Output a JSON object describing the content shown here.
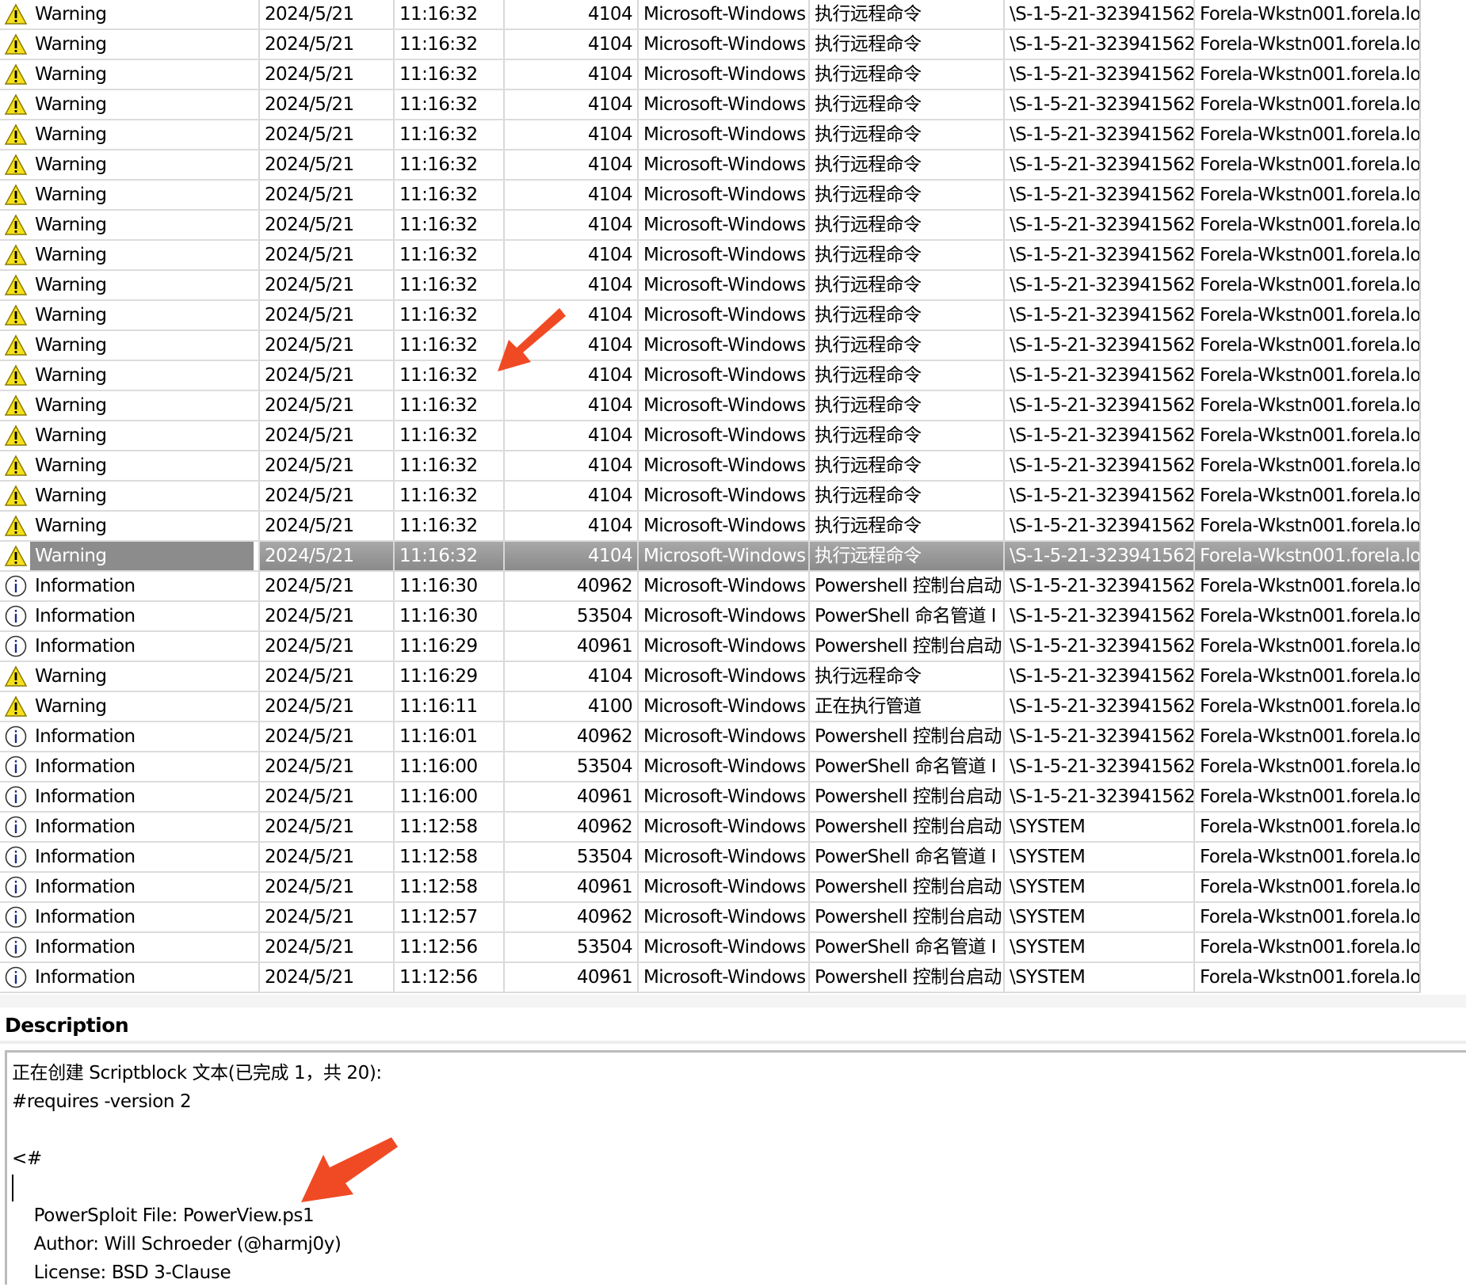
{
  "events": [
    {
      "level": "Warning",
      "date": "2024/5/21",
      "time": "11:16:32",
      "id": "4104",
      "source": "Microsoft-Windows",
      "task": "执行远程命令",
      "user": "\\S-1-5-21-323941562",
      "computer": "Forela-Wkstn001.forela.lo"
    },
    {
      "level": "Warning",
      "date": "2024/5/21",
      "time": "11:16:32",
      "id": "4104",
      "source": "Microsoft-Windows",
      "task": "执行远程命令",
      "user": "\\S-1-5-21-323941562",
      "computer": "Forela-Wkstn001.forela.lo"
    },
    {
      "level": "Warning",
      "date": "2024/5/21",
      "time": "11:16:32",
      "id": "4104",
      "source": "Microsoft-Windows",
      "task": "执行远程命令",
      "user": "\\S-1-5-21-323941562",
      "computer": "Forela-Wkstn001.forela.lo"
    },
    {
      "level": "Warning",
      "date": "2024/5/21",
      "time": "11:16:32",
      "id": "4104",
      "source": "Microsoft-Windows",
      "task": "执行远程命令",
      "user": "\\S-1-5-21-323941562",
      "computer": "Forela-Wkstn001.forela.lo"
    },
    {
      "level": "Warning",
      "date": "2024/5/21",
      "time": "11:16:32",
      "id": "4104",
      "source": "Microsoft-Windows",
      "task": "执行远程命令",
      "user": "\\S-1-5-21-323941562",
      "computer": "Forela-Wkstn001.forela.lo"
    },
    {
      "level": "Warning",
      "date": "2024/5/21",
      "time": "11:16:32",
      "id": "4104",
      "source": "Microsoft-Windows",
      "task": "执行远程命令",
      "user": "\\S-1-5-21-323941562",
      "computer": "Forela-Wkstn001.forela.lo"
    },
    {
      "level": "Warning",
      "date": "2024/5/21",
      "time": "11:16:32",
      "id": "4104",
      "source": "Microsoft-Windows",
      "task": "执行远程命令",
      "user": "\\S-1-5-21-323941562",
      "computer": "Forela-Wkstn001.forela.lo"
    },
    {
      "level": "Warning",
      "date": "2024/5/21",
      "time": "11:16:32",
      "id": "4104",
      "source": "Microsoft-Windows",
      "task": "执行远程命令",
      "user": "\\S-1-5-21-323941562",
      "computer": "Forela-Wkstn001.forela.lo"
    },
    {
      "level": "Warning",
      "date": "2024/5/21",
      "time": "11:16:32",
      "id": "4104",
      "source": "Microsoft-Windows",
      "task": "执行远程命令",
      "user": "\\S-1-5-21-323941562",
      "computer": "Forela-Wkstn001.forela.lo"
    },
    {
      "level": "Warning",
      "date": "2024/5/21",
      "time": "11:16:32",
      "id": "4104",
      "source": "Microsoft-Windows",
      "task": "执行远程命令",
      "user": "\\S-1-5-21-323941562",
      "computer": "Forela-Wkstn001.forela.lo"
    },
    {
      "level": "Warning",
      "date": "2024/5/21",
      "time": "11:16:32",
      "id": "4104",
      "source": "Microsoft-Windows",
      "task": "执行远程命令",
      "user": "\\S-1-5-21-323941562",
      "computer": "Forela-Wkstn001.forela.lo"
    },
    {
      "level": "Warning",
      "date": "2024/5/21",
      "time": "11:16:32",
      "id": "4104",
      "source": "Microsoft-Windows",
      "task": "执行远程命令",
      "user": "\\S-1-5-21-323941562",
      "computer": "Forela-Wkstn001.forela.lo"
    },
    {
      "level": "Warning",
      "date": "2024/5/21",
      "time": "11:16:32",
      "id": "4104",
      "source": "Microsoft-Windows",
      "task": "执行远程命令",
      "user": "\\S-1-5-21-323941562",
      "computer": "Forela-Wkstn001.forela.lo"
    },
    {
      "level": "Warning",
      "date": "2024/5/21",
      "time": "11:16:32",
      "id": "4104",
      "source": "Microsoft-Windows",
      "task": "执行远程命令",
      "user": "\\S-1-5-21-323941562",
      "computer": "Forela-Wkstn001.forela.lo"
    },
    {
      "level": "Warning",
      "date": "2024/5/21",
      "time": "11:16:32",
      "id": "4104",
      "source": "Microsoft-Windows",
      "task": "执行远程命令",
      "user": "\\S-1-5-21-323941562",
      "computer": "Forela-Wkstn001.forela.lo"
    },
    {
      "level": "Warning",
      "date": "2024/5/21",
      "time": "11:16:32",
      "id": "4104",
      "source": "Microsoft-Windows",
      "task": "执行远程命令",
      "user": "\\S-1-5-21-323941562",
      "computer": "Forela-Wkstn001.forela.lo"
    },
    {
      "level": "Warning",
      "date": "2024/5/21",
      "time": "11:16:32",
      "id": "4104",
      "source": "Microsoft-Windows",
      "task": "执行远程命令",
      "user": "\\S-1-5-21-323941562",
      "computer": "Forela-Wkstn001.forela.lo"
    },
    {
      "level": "Warning",
      "date": "2024/5/21",
      "time": "11:16:32",
      "id": "4104",
      "source": "Microsoft-Windows",
      "task": "执行远程命令",
      "user": "\\S-1-5-21-323941562",
      "computer": "Forela-Wkstn001.forela.lo"
    },
    {
      "level": "Warning",
      "date": "2024/5/21",
      "time": "11:16:32",
      "id": "4104",
      "source": "Microsoft-Windows",
      "task": "执行远程命令",
      "user": "\\S-1-5-21-323941562",
      "computer": "Forela-Wkstn001.forela.lo",
      "selected": true
    },
    {
      "level": "Information",
      "date": "2024/5/21",
      "time": "11:16:30",
      "id": "40962",
      "source": "Microsoft-Windows",
      "task": "Powershell 控制台启动",
      "user": "\\S-1-5-21-323941562",
      "computer": "Forela-Wkstn001.forela.lo"
    },
    {
      "level": "Information",
      "date": "2024/5/21",
      "time": "11:16:30",
      "id": "53504",
      "source": "Microsoft-Windows",
      "task": "PowerShell 命名管道 I",
      "user": "\\S-1-5-21-323941562",
      "computer": "Forela-Wkstn001.forela.lo"
    },
    {
      "level": "Information",
      "date": "2024/5/21",
      "time": "11:16:29",
      "id": "40961",
      "source": "Microsoft-Windows",
      "task": "Powershell 控制台启动",
      "user": "\\S-1-5-21-323941562",
      "computer": "Forela-Wkstn001.forela.lo"
    },
    {
      "level": "Warning",
      "date": "2024/5/21",
      "time": "11:16:29",
      "id": "4104",
      "source": "Microsoft-Windows",
      "task": "执行远程命令",
      "user": "\\S-1-5-21-323941562",
      "computer": "Forela-Wkstn001.forela.lo"
    },
    {
      "level": "Warning",
      "date": "2024/5/21",
      "time": "11:16:11",
      "id": "4100",
      "source": "Microsoft-Windows",
      "task": "正在执行管道",
      "user": "\\S-1-5-21-323941562",
      "computer": "Forela-Wkstn001.forela.lo"
    },
    {
      "level": "Information",
      "date": "2024/5/21",
      "time": "11:16:01",
      "id": "40962",
      "source": "Microsoft-Windows",
      "task": "Powershell 控制台启动",
      "user": "\\S-1-5-21-323941562",
      "computer": "Forela-Wkstn001.forela.lo"
    },
    {
      "level": "Information",
      "date": "2024/5/21",
      "time": "11:16:00",
      "id": "53504",
      "source": "Microsoft-Windows",
      "task": "PowerShell 命名管道 I",
      "user": "\\S-1-5-21-323941562",
      "computer": "Forela-Wkstn001.forela.lo"
    },
    {
      "level": "Information",
      "date": "2024/5/21",
      "time": "11:16:00",
      "id": "40961",
      "source": "Microsoft-Windows",
      "task": "Powershell 控制台启动",
      "user": "\\S-1-5-21-323941562",
      "computer": "Forela-Wkstn001.forela.lo"
    },
    {
      "level": "Information",
      "date": "2024/5/21",
      "time": "11:12:58",
      "id": "40962",
      "source": "Microsoft-Windows",
      "task": "Powershell 控制台启动",
      "user": "\\SYSTEM",
      "computer": "Forela-Wkstn001.forela.lo"
    },
    {
      "level": "Information",
      "date": "2024/5/21",
      "time": "11:12:58",
      "id": "53504",
      "source": "Microsoft-Windows",
      "task": "PowerShell 命名管道 I",
      "user": "\\SYSTEM",
      "computer": "Forela-Wkstn001.forela.lo"
    },
    {
      "level": "Information",
      "date": "2024/5/21",
      "time": "11:12:58",
      "id": "40961",
      "source": "Microsoft-Windows",
      "task": "Powershell 控制台启动",
      "user": "\\SYSTEM",
      "computer": "Forela-Wkstn001.forela.lo"
    },
    {
      "level": "Information",
      "date": "2024/5/21",
      "time": "11:12:57",
      "id": "40962",
      "source": "Microsoft-Windows",
      "task": "Powershell 控制台启动",
      "user": "\\SYSTEM",
      "computer": "Forela-Wkstn001.forela.lo"
    },
    {
      "level": "Information",
      "date": "2024/5/21",
      "time": "11:12:56",
      "id": "53504",
      "source": "Microsoft-Windows",
      "task": "PowerShell 命名管道 I",
      "user": "\\SYSTEM",
      "computer": "Forela-Wkstn001.forela.lo"
    },
    {
      "level": "Information",
      "date": "2024/5/21",
      "time": "11:12:56",
      "id": "40961",
      "source": "Microsoft-Windows",
      "task": "Powershell 控制台启动",
      "user": "\\SYSTEM",
      "computer": "Forela-Wkstn001.forela.lo"
    }
  ],
  "description": {
    "heading": "Description",
    "lines": [
      "正在创建 Scriptblock 文本(已完成 1，共 20):",
      "#requires -version 2",
      "",
      "<#",
      "",
      "    PowerSploit File: PowerView.ps1",
      "    Author: Will Schroeder (@harmj0y)",
      "    License: BSD 3-Clause"
    ]
  },
  "colors": {
    "annotation_arrow": "#f04a24",
    "selected_row": "#8c8c8c",
    "warning_icon": "#f5e11a"
  },
  "icons": {
    "Warning": "warning-triangle-icon",
    "Information": "info-circle-icon"
  }
}
